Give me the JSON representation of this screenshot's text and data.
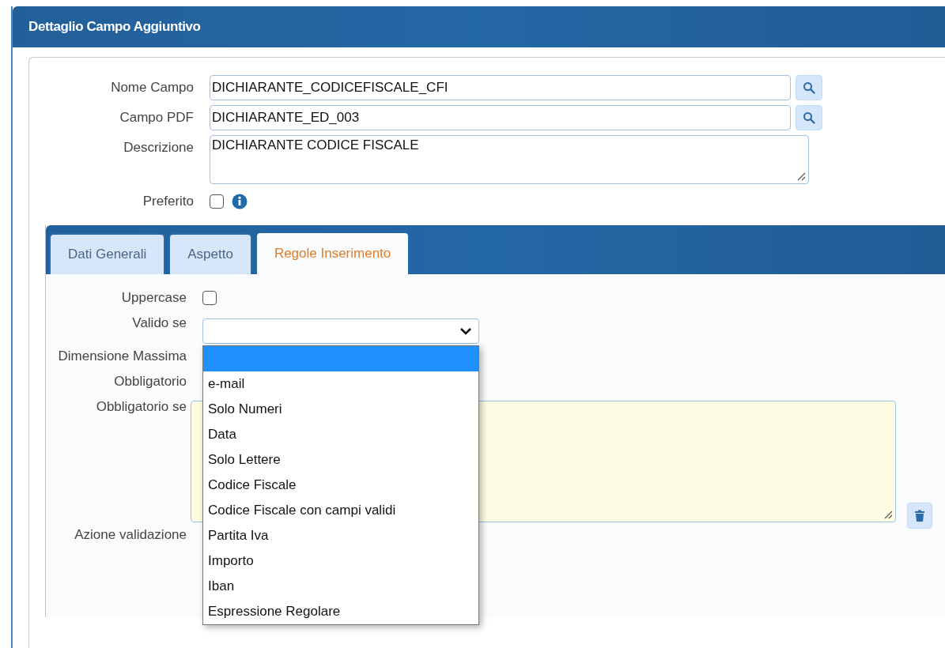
{
  "window": {
    "title": "Dettaglio Campo Aggiuntivo"
  },
  "fields": [
    {
      "kind": "lookup",
      "label": "Nome Campo",
      "value": "DICHIARANTE_CODICEFISCALE_CFI"
    },
    {
      "kind": "lookup",
      "label": "Campo PDF",
      "value": "DICHIARANTE_ED_003"
    },
    {
      "kind": "textarea",
      "label": "Descrizione",
      "value": "DICHIARANTE CODICE FISCALE"
    },
    {
      "kind": "checkbox",
      "label": "Preferito",
      "checked": false
    }
  ],
  "tabs": [
    {
      "label": "Dati Generali",
      "selected": false
    },
    {
      "label": "Aspetto",
      "selected": false
    },
    {
      "label": "Regole Inserimento",
      "selected": true
    }
  ],
  "rules": {
    "uppercase": {
      "label": "Uppercase",
      "checked": false
    },
    "valid_if": {
      "label": "Valido se",
      "blank_option_selected": true,
      "options": [
        {
          "label": "e-mail",
          "selected": false
        },
        {
          "label": "Solo Numeri",
          "selected": false
        },
        {
          "label": "Data",
          "selected": false
        },
        {
          "label": "Solo Lettere",
          "selected": false
        },
        {
          "label": "Codice Fiscale",
          "selected": false
        },
        {
          "label": "Codice Fiscale con campi validi",
          "selected": false
        },
        {
          "label": "Partita Iva",
          "selected": false
        },
        {
          "label": "Importo",
          "selected": false
        },
        {
          "label": "Iban",
          "selected": false
        },
        {
          "label": "Espressione Regolare",
          "selected": false
        }
      ]
    },
    "max_size_label": "Dimensione Massima",
    "required_label": "Obbligatorio",
    "required_if_label": "Obbligatorio se",
    "validation_action_label": "Azione validazione"
  }
}
